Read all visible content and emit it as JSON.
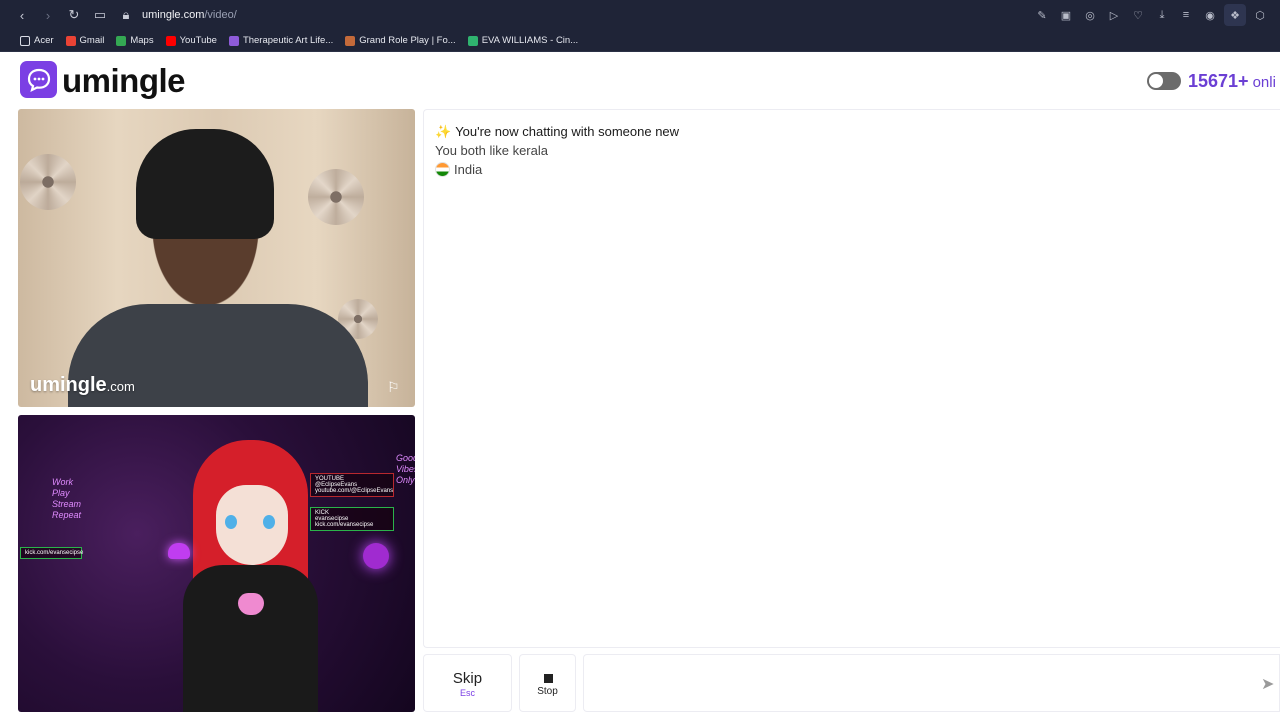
{
  "browser": {
    "url_host": "umingle.com",
    "url_path": "/video/",
    "bookmarks": [
      {
        "label": "Acer",
        "color": "#d9dce6"
      },
      {
        "label": "Gmail",
        "color": "#ea4335"
      },
      {
        "label": "Maps",
        "color": "#34a853"
      },
      {
        "label": "YouTube",
        "color": "#ff0000"
      },
      {
        "label": "Therapeutic Art Life...",
        "color": "#8e5bd9"
      },
      {
        "label": "Grand Role Play | Fo...",
        "color": "#c46a3a"
      },
      {
        "label": "EVA WILLIAMS - Cin...",
        "color": "#2fb36f"
      }
    ]
  },
  "header": {
    "logo_text": "umingle",
    "online_count": "15671+",
    "online_label": "onli",
    "accent_color": "#7b3fe4"
  },
  "stranger_video": {
    "watermark_brand": "umingle",
    "watermark_domain": ".com"
  },
  "self_video": {
    "neon_left": "Work\nPlay\nStream\nRepeat",
    "neon_right": "Good\nVibes\nOnly",
    "panel_youtube": "YOUTUBE\n@EclipseEvans\nyoutube.com/@EclipseEvans",
    "panel_kick": "KICK\nevansecipse\nkick.com/evansecipse",
    "panel_left": "kick.com/evansecipse"
  },
  "chat": {
    "messages": [
      {
        "text": "You're now chatting with someone new",
        "icon": "sparkle-icon"
      },
      {
        "text": "You both like kerala"
      },
      {
        "text": "India",
        "icon": "india-flag-icon"
      }
    ]
  },
  "controls": {
    "skip_label": "Skip",
    "skip_key": "Esc",
    "stop_label": "Stop",
    "message_placeholder": ""
  }
}
